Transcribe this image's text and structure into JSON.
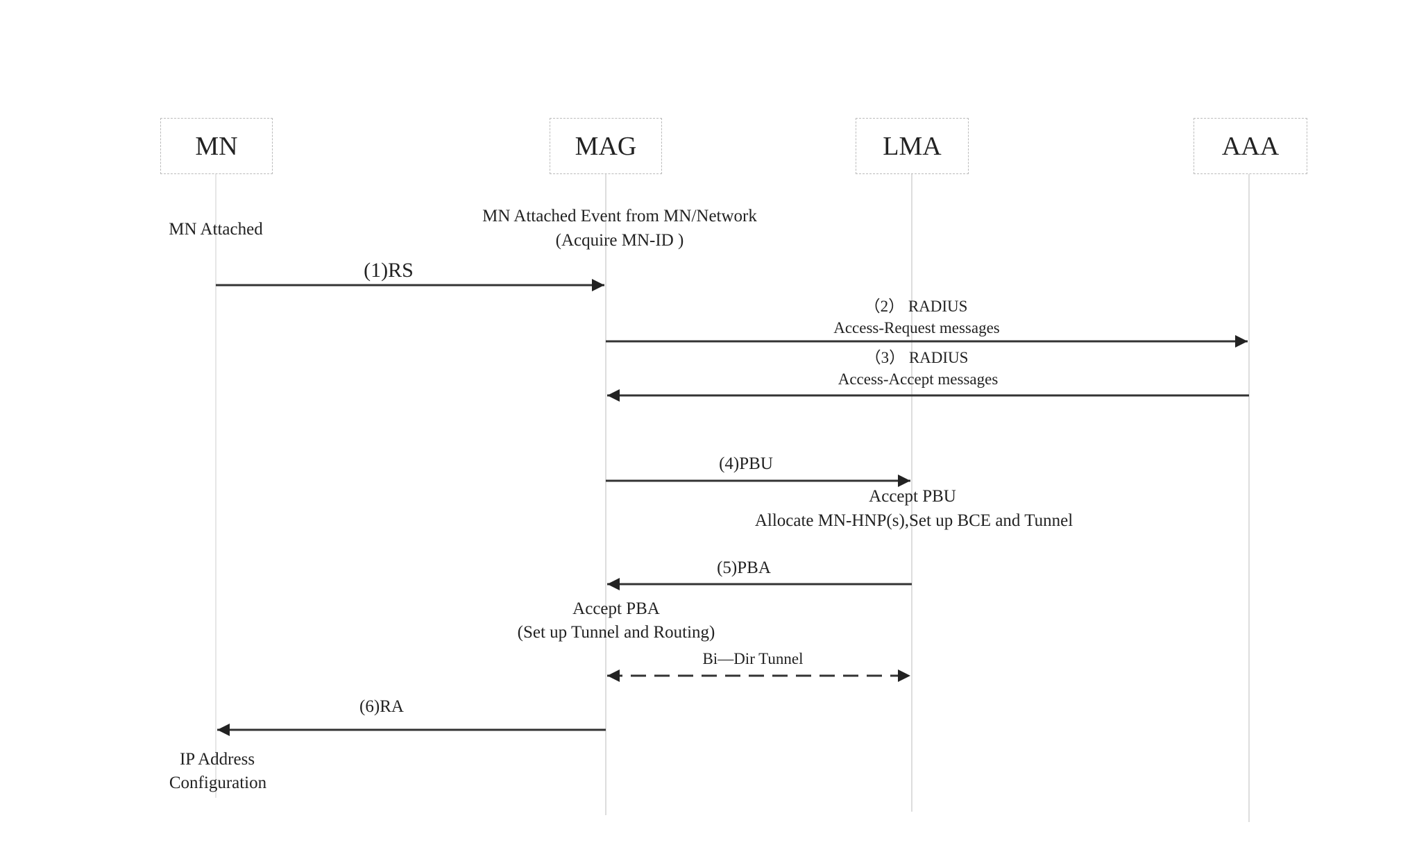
{
  "participants": [
    {
      "id": "mn",
      "label": "MN"
    },
    {
      "id": "mag",
      "label": "MAG"
    },
    {
      "id": "lma",
      "label": "LMA"
    },
    {
      "id": "aaa",
      "label": "AAA"
    }
  ],
  "notes": {
    "mn_attached": "MN  Attached",
    "mag_event_1": "MN  Attached  Event  from  MN/Network",
    "mag_event_2": "(Acquire   MN-ID )",
    "lma_accept_1": "Accept   PBU",
    "lma_accept_2": "Allocate  MN-HNP(s),Set up  BCE  and  Tunnel",
    "mag_accept_1": "Accept  PBA",
    "mag_accept_2": "(Set up Tunnel  and  Routing)",
    "mn_ip_1": "IP  Address",
    "mn_ip_2": "Configuration"
  },
  "messages": [
    {
      "label": "(1)RS",
      "from": "mn",
      "to": "mag",
      "style": "solid"
    },
    {
      "label": "（2） RADIUS",
      "sublabel": "Access-Request messages",
      "from": "mag",
      "to": "aaa",
      "style": "solid"
    },
    {
      "label": "（3） RADIUS",
      "sublabel": "Access-Accept messages",
      "from": "aaa",
      "to": "mag",
      "style": "solid"
    },
    {
      "label": "(4)PBU",
      "from": "mag",
      "to": "lma",
      "style": "solid"
    },
    {
      "label": "(5)PBA",
      "from": "lma",
      "to": "mag",
      "style": "solid"
    },
    {
      "label": "Bi—Dir  Tunnel",
      "from": "mag",
      "to": "lma",
      "style": "dashed-bidirectional"
    },
    {
      "label": "(6)RA",
      "from": "mag",
      "to": "mn",
      "style": "solid"
    }
  ]
}
